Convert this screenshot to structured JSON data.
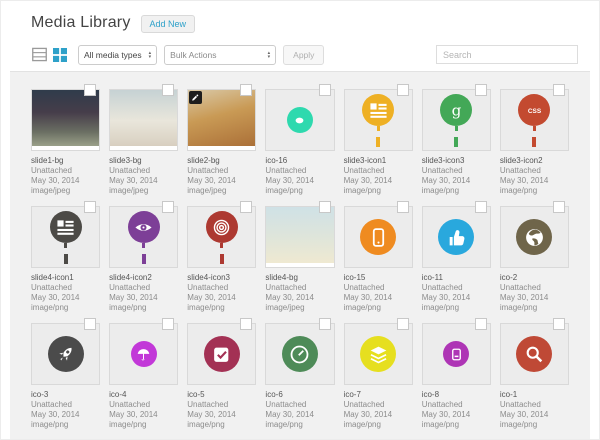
{
  "header": {
    "title": "Media Library",
    "add_new_label": "Add New"
  },
  "toolbar": {
    "view_list_icon": "list-view",
    "view_grid_icon": "grid-view",
    "active_view": "grid",
    "media_type_filter": "All media types",
    "bulk_actions": "Bulk Actions",
    "apply_label": "Apply",
    "search_placeholder": "Search"
  },
  "colors": {
    "accent_blue": "#2ea1c9",
    "content_bg": "#f1f1f1",
    "icon_tile_bg": "#ececec",
    "tile_border": "#d9d9d9"
  },
  "grid": {
    "items": [
      {
        "title": "slide1-bg",
        "status": "Unattached",
        "date": "May 30, 2014",
        "mime": "image/jpeg",
        "kind": "photo",
        "edit_badge": false,
        "photo": {
          "angle": 180,
          "stops": [
            "#2f3c4b",
            "#463d4a 40%",
            "#6b6f63 75%",
            "#9aa089"
          ]
        }
      },
      {
        "title": "slide3-bg",
        "status": "Unattached",
        "date": "May 30, 2014",
        "mime": "image/jpeg",
        "kind": "photo",
        "edit_badge": false,
        "photo": {
          "angle": 180,
          "stops": [
            "#c6d2d4",
            "#e9e6db 55%",
            "#d8cfc0"
          ]
        }
      },
      {
        "title": "slide2-bg",
        "status": "Unattached",
        "date": "May 30, 2014",
        "mime": "image/jpeg",
        "kind": "photo",
        "edit_badge": true,
        "photo": {
          "angle": 165,
          "stops": [
            "#d9c8a6",
            "#c99a55 45%",
            "#ab7038"
          ]
        }
      },
      {
        "title": "ico-16",
        "status": "Unattached",
        "date": "May 30, 2014",
        "mime": "image/png",
        "kind": "icon",
        "edit_badge": false,
        "icon": {
          "shape": "circle",
          "glyph": "donut",
          "color": "#2ed9ae",
          "size": "small"
        }
      },
      {
        "title": "slide3-icon1",
        "status": "Unattached",
        "date": "May 30, 2014",
        "mime": "image/png",
        "kind": "icon",
        "edit_badge": false,
        "icon": {
          "shape": "balloon",
          "glyph": "list",
          "color": "#eeb024"
        }
      },
      {
        "title": "slide3-icon3",
        "status": "Unattached",
        "date": "May 30, 2014",
        "mime": "image/png",
        "kind": "icon",
        "edit_badge": false,
        "icon": {
          "shape": "balloon",
          "glyph": "letter-g",
          "color": "#43a857"
        }
      },
      {
        "title": "slide3-icon2",
        "status": "Unattached",
        "date": "May 30, 2014",
        "mime": "image/png",
        "kind": "icon",
        "edit_badge": false,
        "icon": {
          "shape": "balloon",
          "glyph": "css-text",
          "color": "#c34a30"
        }
      },
      {
        "title": "slide4-icon1",
        "status": "Unattached",
        "date": "May 30, 2014",
        "mime": "image/png",
        "kind": "icon",
        "edit_badge": false,
        "icon": {
          "shape": "balloon",
          "glyph": "list",
          "color": "#4c4a46"
        }
      },
      {
        "title": "slide4-icon2",
        "status": "Unattached",
        "date": "May 30, 2014",
        "mime": "image/png",
        "kind": "icon",
        "edit_badge": false,
        "icon": {
          "shape": "balloon",
          "glyph": "eye",
          "color": "#7d3f97"
        }
      },
      {
        "title": "slide4-icon3",
        "status": "Unattached",
        "date": "May 30, 2014",
        "mime": "image/png",
        "kind": "icon",
        "edit_badge": false,
        "icon": {
          "shape": "balloon",
          "glyph": "spiral",
          "color": "#ad3931"
        }
      },
      {
        "title": "slide4-bg",
        "status": "Unattached",
        "date": "May 30, 2014",
        "mime": "image/jpeg",
        "kind": "photo",
        "edit_badge": false,
        "photo": {
          "angle": 180,
          "stops": [
            "#cfe1e6",
            "#dfe5da 55%",
            "#efe9d1"
          ]
        }
      },
      {
        "title": "ico-15",
        "status": "Unattached",
        "date": "May 30, 2014",
        "mime": "image/png",
        "kind": "icon",
        "edit_badge": false,
        "icon": {
          "shape": "circle",
          "glyph": "phone",
          "color": "#ef8b20"
        }
      },
      {
        "title": "ico-11",
        "status": "Unattached",
        "date": "May 30, 2014",
        "mime": "image/png",
        "kind": "icon",
        "edit_badge": false,
        "icon": {
          "shape": "circle",
          "glyph": "thumbs-up",
          "color": "#29a8dd"
        }
      },
      {
        "title": "ico-2",
        "status": "Unattached",
        "date": "May 30, 2014",
        "mime": "image/png",
        "kind": "icon",
        "edit_badge": false,
        "icon": {
          "shape": "circle",
          "glyph": "globe",
          "color": "#6f654a"
        }
      },
      {
        "title": "ico-3",
        "status": "Unattached",
        "date": "May 30, 2014",
        "mime": "image/png",
        "kind": "icon",
        "edit_badge": false,
        "icon": {
          "shape": "circle",
          "glyph": "rocket",
          "color": "#4b4b4b"
        }
      },
      {
        "title": "ico-4",
        "status": "Unattached",
        "date": "May 30, 2014",
        "mime": "image/png",
        "kind": "icon",
        "edit_badge": false,
        "icon": {
          "shape": "circle",
          "glyph": "umbrella",
          "color": "#c238d8",
          "size": "small"
        }
      },
      {
        "title": "ico-5",
        "status": "Unattached",
        "date": "May 30, 2014",
        "mime": "image/png",
        "kind": "icon",
        "edit_badge": false,
        "icon": {
          "shape": "circle",
          "glyph": "checkbox",
          "color": "#a33154"
        }
      },
      {
        "title": "ico-6",
        "status": "Unattached",
        "date": "May 30, 2014",
        "mime": "image/png",
        "kind": "icon",
        "edit_badge": false,
        "icon": {
          "shape": "circle",
          "glyph": "gauge",
          "color": "#4e8b58"
        }
      },
      {
        "title": "ico-7",
        "status": "Unattached",
        "date": "May 30, 2014",
        "mime": "image/png",
        "kind": "icon",
        "edit_badge": false,
        "icon": {
          "shape": "circle",
          "glyph": "layers",
          "color": "#e6df1f"
        }
      },
      {
        "title": "ico-8",
        "status": "Unattached",
        "date": "May 30, 2014",
        "mime": "image/png",
        "kind": "icon",
        "edit_badge": false,
        "icon": {
          "shape": "circle",
          "glyph": "card",
          "color": "#ae35b5",
          "size": "small"
        }
      },
      {
        "title": "ico-1",
        "status": "Unattached",
        "date": "May 30, 2014",
        "mime": "image/png",
        "kind": "icon",
        "edit_badge": false,
        "icon": {
          "shape": "circle",
          "glyph": "search",
          "color": "#bf4936"
        }
      }
    ]
  }
}
